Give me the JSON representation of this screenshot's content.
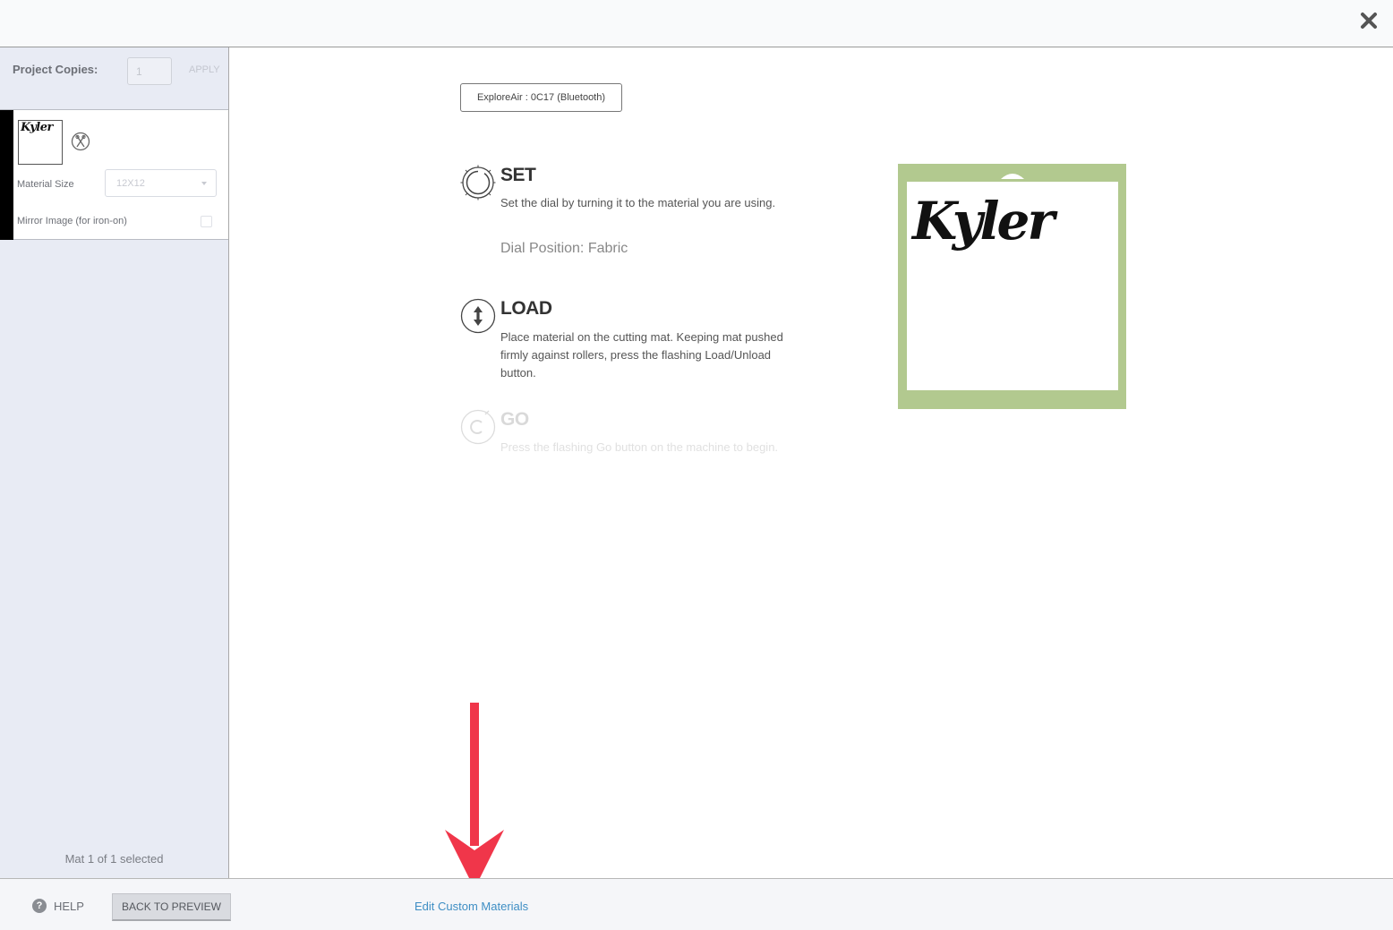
{
  "project": {
    "copies_label": "Project Copies:",
    "copies_value": "1",
    "apply_label": "APPLY"
  },
  "mat": {
    "thumbnail_text": "Kyler",
    "material_size_label": "Material Size",
    "material_size_value": "12X12",
    "mirror_label": "Mirror Image (for iron-on)",
    "count_label": "Mat 1 of 1 selected"
  },
  "machine": {
    "selected": "ExploreAir : 0C17 (Bluetooth)"
  },
  "steps": {
    "set": {
      "title": "SET",
      "description": "Set the dial by turning it to the material you are using.",
      "dial_position": "Dial Position: Fabric"
    },
    "load": {
      "title": "LOAD",
      "description": "Place material on the cutting mat. Keeping mat pushed firmly against rollers, press the flashing Load/Unload button."
    },
    "go": {
      "title": "GO",
      "description": "Press the flashing Go button on the machine to begin."
    }
  },
  "preview": {
    "design_text": "Kyler",
    "mat_color": "#b2c98f"
  },
  "footer": {
    "help_label": "HELP",
    "back_label": "BACK TO PREVIEW",
    "edit_materials_label": "Edit Custom Materials"
  },
  "annotation": {
    "arrow_color": "#f0364a"
  }
}
